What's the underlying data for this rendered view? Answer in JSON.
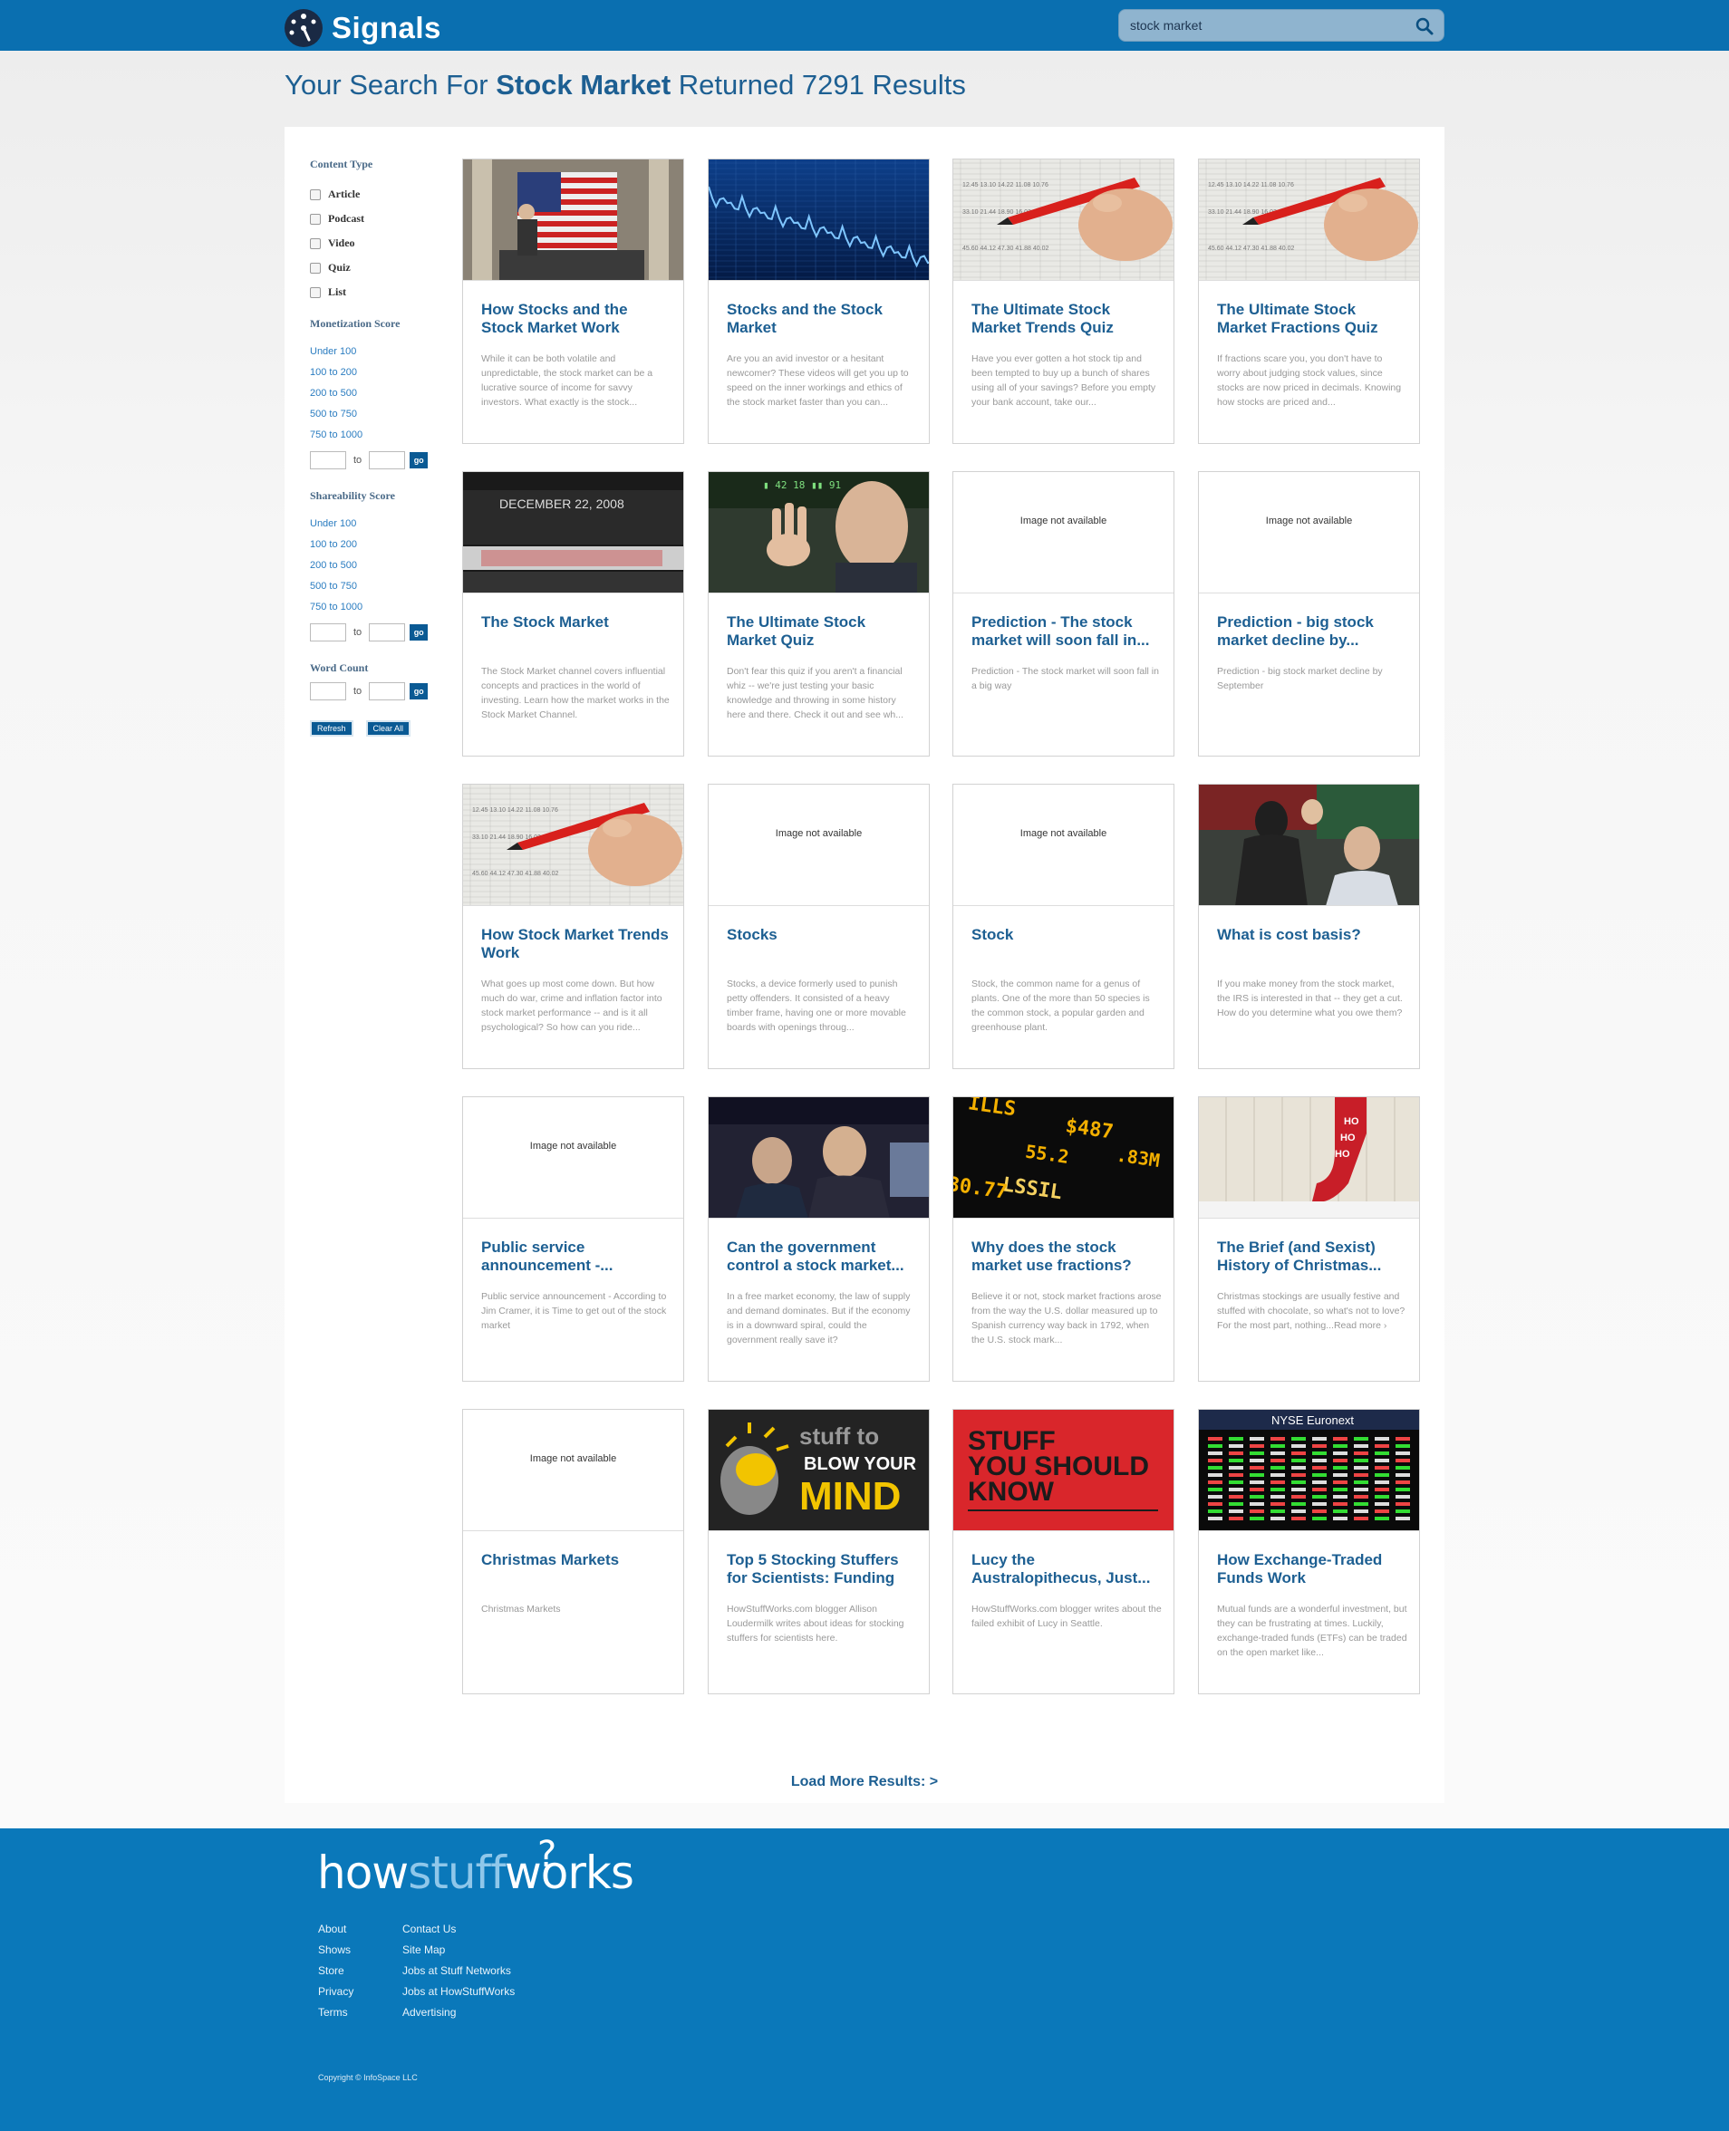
{
  "header": {
    "brand": "Signals",
    "search_value": "stock market"
  },
  "results": {
    "prefix": "Your Search For ",
    "term": "Stock Market",
    "suffix": " Returned 7291 Results"
  },
  "filters": {
    "content_type": {
      "title": "Content Type",
      "options": [
        "Article",
        "Podcast",
        "Video",
        "Quiz",
        "List"
      ]
    },
    "monetization": {
      "title": "Monetization Score",
      "ranges": [
        "Under 100",
        "100 to 200",
        "200 to 500",
        "500 to 750",
        "750 to 1000"
      ],
      "to_label": "to",
      "go": "go"
    },
    "shareability": {
      "title": "Shareability Score",
      "ranges": [
        "Under 100",
        "100 to 200",
        "200 to 500",
        "500 to 750",
        "750 to 1000"
      ],
      "to_label": "to",
      "go": "go"
    },
    "word_count": {
      "title": "Word Count",
      "to_label": "to",
      "go": "go"
    },
    "refresh": "Refresh",
    "clear_all": "Clear All"
  },
  "image_na_text": "Image not available",
  "cards": [
    {
      "title": "How Stocks and the Stock Market Work",
      "desc": "While it can be both volatile and unpredictable, the stock market can be a lucrative source of income for savvy investors. What exactly is the stock...",
      "image": "nyse-flag"
    },
    {
      "title": "Stocks and the Stock Market",
      "desc": "Are you an avid investor or a hesitant newcomer? These videos will get you up to speed on the inner workings and ethics of the stock market faster than you can...",
      "image": "chart-blue"
    },
    {
      "title": "The Ultimate Stock Market Trends Quiz",
      "desc": "Have you ever gotten a hot stock tip and been tempted to buy up a bunch of shares using all of your savings? Before you empty your bank account, take our...",
      "image": "red-pen"
    },
    {
      "title": "The Ultimate Stock Market Fractions Quiz",
      "desc": "If fractions scare you, you don't have to worry about judging stock values, since stocks are now priced in decimals. Knowing how stocks are priced and...",
      "image": "red-pen"
    },
    {
      "title": "The Stock Market",
      "desc": "The Stock Market channel covers influential concepts and practices in the world of investing. Learn how the market works in the Stock Market Channel.",
      "image": "ticker-building"
    },
    {
      "title": "The Ultimate Stock Market Quiz",
      "desc": "Don't fear this quiz if you aren't a financial whiz -- we're just testing your basic knowledge and throwing in some history here and there. Check it out and see wh...",
      "image": "trader-hand"
    },
    {
      "title": "Prediction - The stock market will soon fall in...",
      "desc": "Prediction - The stock market will soon fall in a big way",
      "image": "na"
    },
    {
      "title": "Prediction - big stock market decline by...",
      "desc": "Prediction - big stock market decline by September",
      "image": "na"
    },
    {
      "title": "How Stock Market Trends Work",
      "desc": "What goes up most come down. But how much do war, crime and inflation factor into stock market performance -- and is it all psychological? So how can you ride...",
      "image": "red-pen"
    },
    {
      "title": "Stocks",
      "desc": "Stocks, a device formerly used to punish petty offenders. It consisted of a heavy timber frame, having one or more movable boards with openings throug...",
      "image": "na"
    },
    {
      "title": "Stock",
      "desc": "Stock, the common name for a genus of plants. One of the more than 50 species is the common stock, a popular garden and greenhouse plant.",
      "image": "na"
    },
    {
      "title": "What is cost basis?",
      "desc": "If you make money from the stock market, the IRS is interested in that -- they get a cut. How do you determine what you owe them?",
      "image": "high-five"
    },
    {
      "title": "Public service announcement -...",
      "desc": "Public service announcement - According to Jim Cramer, it is Time to get out of the stock market",
      "image": "na"
    },
    {
      "title": "Can the government control a stock market...",
      "desc": "In a free market economy, the law of supply and demand dominates. But if the economy is in a downward spiral, could the government really save it?",
      "image": "floor-traders"
    },
    {
      "title": "Why does the stock market use fractions?",
      "desc": "Believe it or not, stock market fractions arose from the way the U.S. dollar measured up to Spanish currency way back in 1792, when the U.S. stock mark...",
      "image": "ticker-board"
    },
    {
      "title": "The Brief (and Sexist) History of Christmas...",
      "desc": "Christmas stockings are usually festive and stuffed with chocolate, so what's not to love? For the most part, nothing...Read more ›",
      "image": "stocking"
    },
    {
      "title": "Christmas Markets",
      "desc": "Christmas Markets",
      "image": "na"
    },
    {
      "title": "Top 5 Stocking Stuffers for Scientists: Funding",
      "desc": "HowStuffWorks.com blogger Allison Loudermilk writes about ideas for stocking stuffers for scientists here.",
      "image": "blow-mind"
    },
    {
      "title": "Lucy the Australopithecus, Just...",
      "desc": "HowStuffWorks.com blogger writes about the failed exhibit of Lucy in Seattle.",
      "image": "ssyk"
    },
    {
      "title": "How Exchange-Traded Funds Work",
      "desc": "Mutual funds are a wonderful investment, but they can be frustrating at times. Luckily, exchange-traded funds (ETFs) can be traded on the open market like...",
      "image": "euronext"
    }
  ],
  "thumb_text": {
    "ticker_date": "DECEMBER 22, 2008",
    "ticker_board": [
      "ILLS",
      "$487",
      ".83M",
      "55.2",
      "LSSIL",
      "30.77"
    ],
    "ho": [
      "HO",
      "HO",
      "HO"
    ],
    "blow1": "stuff to",
    "blow2": "BLOW YOUR",
    "blow3": "MIND",
    "ssyk": [
      "STUFF",
      "YOU SHOULD",
      "KNOW"
    ],
    "euronext": "NYSE Euronext"
  },
  "load_more": "Load More Results: >",
  "footer": {
    "logo_how": "how",
    "logo_stuff": "stuff",
    "logo_works": "works",
    "col1": [
      "About",
      "Shows",
      "Store",
      "Privacy",
      "Terms"
    ],
    "col2": [
      "Contact Us",
      "Site Map",
      "Jobs at Stuff Networks",
      "Jobs at HowStuffWorks",
      "Advertising"
    ],
    "copyright": "Copyright © InfoSpace LLC"
  }
}
